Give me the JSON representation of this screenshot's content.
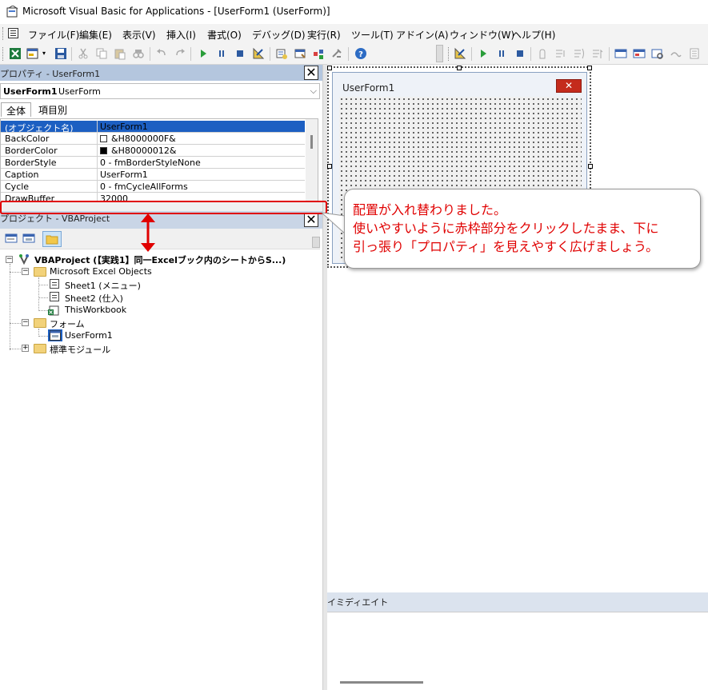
{
  "window": {
    "title": "Microsoft Visual Basic for Applications - [UserForm1 (UserForm)]"
  },
  "menu": [
    "ファイル(F)",
    "編集(E)",
    "表示(V)",
    "挿入(I)",
    "書式(O)",
    "デバッグ(D)",
    "実行(R)",
    "ツール(T)",
    "アドイン(A)",
    "ウィンドウ(W)",
    "ヘルプ(H)"
  ],
  "properties": {
    "title": "プロパティ - UserForm1",
    "object_name": "UserForm1",
    "object_type": "UserForm",
    "tabs": [
      "全体",
      "項目別"
    ],
    "rows": [
      {
        "name": "(オブジェクト名)",
        "value": "UserForm1"
      },
      {
        "name": "BackColor",
        "value": "&H8000000F&"
      },
      {
        "name": "BorderColor",
        "value": "&H80000012&"
      },
      {
        "name": "BorderStyle",
        "value": "0 - fmBorderStyleNone"
      },
      {
        "name": "Caption",
        "value": "UserForm1"
      },
      {
        "name": "Cycle",
        "value": "0 - fmCycleAllForms"
      },
      {
        "name": "DrawBuffer",
        "value": "32000"
      }
    ]
  },
  "project": {
    "title": "プロジェクト - VBAProject",
    "root": "VBAProject (【実践1】同一Excelブック内のシートからS...)",
    "excel_objects": "Microsoft Excel Objects",
    "sheet1": "Sheet1 (メニュー)",
    "sheet2": "Sheet2 (仕入)",
    "thisworkbook": "ThisWorkbook",
    "forms_folder": "フォーム",
    "userform": "UserForm1",
    "modules_folder": "標準モジュール"
  },
  "designer": {
    "form_caption": "UserForm1"
  },
  "immediate": {
    "title": "イミディエイト"
  },
  "callout": {
    "line1": "配置が入れ替わりました。",
    "line2": "使いやすいように赤枠部分をクリックしたまま、下に",
    "line3": "引っ張り「プロパティ」を見えやすく広げましょう。"
  },
  "colors": {
    "annotation_red": "#e00000",
    "panel_title": "#b4c6de",
    "selection": "#1c5fc2"
  }
}
